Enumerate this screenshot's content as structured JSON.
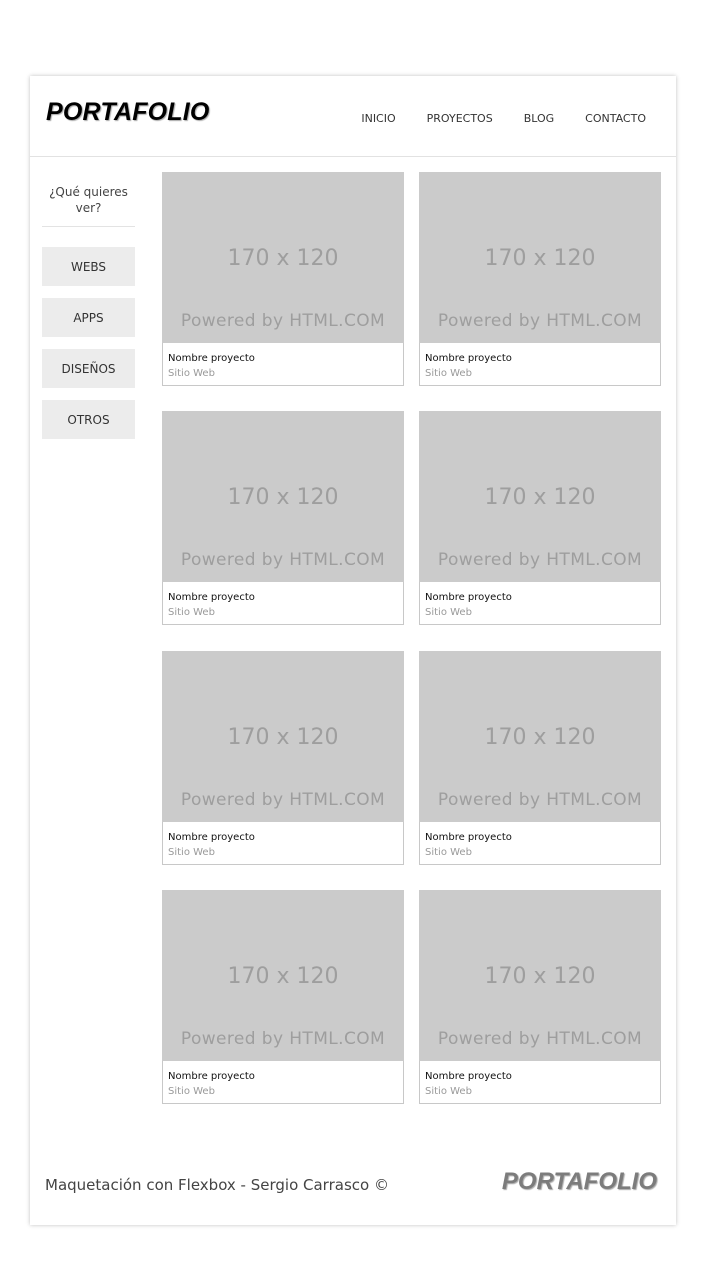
{
  "header": {
    "logo": "PORTAFOLIO",
    "nav": [
      "INICIO",
      "PROYECTOS",
      "BLOG",
      "CONTACTO"
    ]
  },
  "sidebar": {
    "question": "¿Qué quieres ver?",
    "filters": [
      "WEBS",
      "APPS",
      "DISEÑOS",
      "OTROS"
    ]
  },
  "projects": [
    {
      "image_text": "170 x 120",
      "image_caption": "Powered by HTML.COM",
      "name": "Nombre proyecto",
      "type": "Sitio Web"
    },
    {
      "image_text": "170 x 120",
      "image_caption": "Powered by HTML.COM",
      "name": "Nombre proyecto",
      "type": "Sitio Web"
    },
    {
      "image_text": "170 x 120",
      "image_caption": "Powered by HTML.COM",
      "name": "Nombre proyecto",
      "type": "Sitio Web"
    },
    {
      "image_text": "170 x 120",
      "image_caption": "Powered by HTML.COM",
      "name": "Nombre proyecto",
      "type": "Sitio Web"
    },
    {
      "image_text": "170 x 120",
      "image_caption": "Powered by HTML.COM",
      "name": "Nombre proyecto",
      "type": "Sitio Web"
    },
    {
      "image_text": "170 x 120",
      "image_caption": "Powered by HTML.COM",
      "name": "Nombre proyecto",
      "type": "Sitio Web"
    },
    {
      "image_text": "170 x 120",
      "image_caption": "Powered by HTML.COM",
      "name": "Nombre proyecto",
      "type": "Sitio Web"
    },
    {
      "image_text": "170 x 120",
      "image_caption": "Powered by HTML.COM",
      "name": "Nombre proyecto",
      "type": "Sitio Web"
    }
  ],
  "footer": {
    "text": "Maquetación con Flexbox - Sergio Carrasco ©",
    "logo": "PORTAFOLIO"
  }
}
